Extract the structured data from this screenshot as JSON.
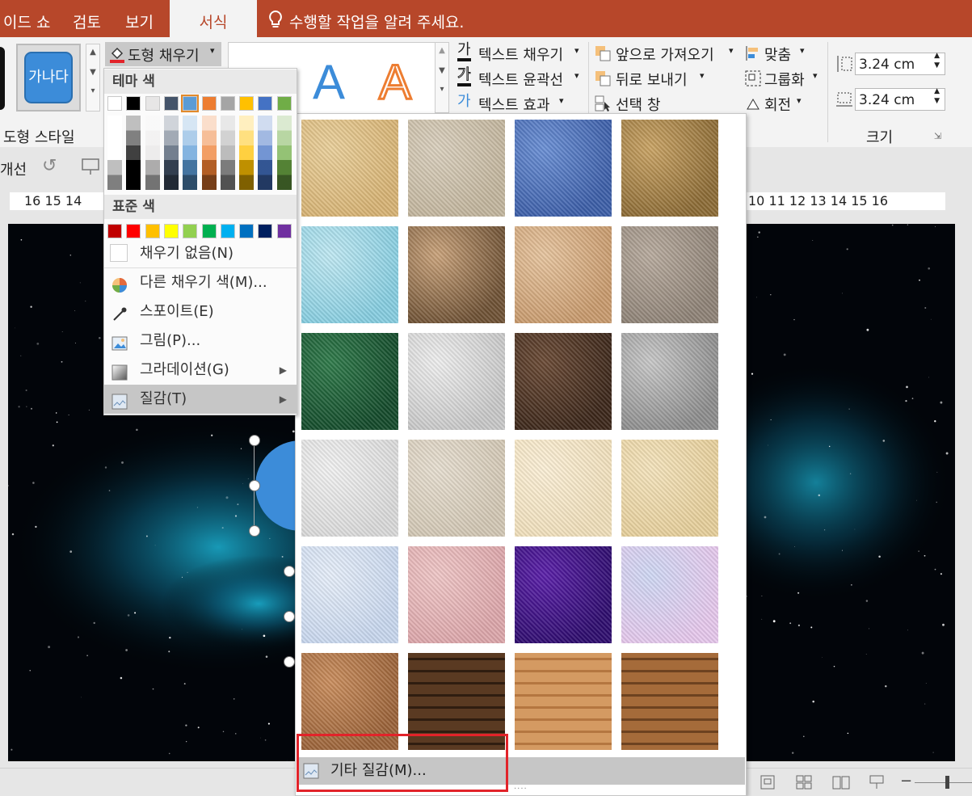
{
  "tabs": [
    {
      "label": "이드 쇼",
      "active": false
    },
    {
      "label": "검토",
      "active": false
    },
    {
      "label": "보기",
      "active": false
    },
    {
      "label": "서식",
      "active": true
    }
  ],
  "tell_me": "수행할 작업을 알려 주세요.",
  "ribbon": {
    "shape_sample": "가나다",
    "shape_fill_label": "도형 채우기",
    "shape_styles_group": "도형 스타일",
    "text_fill": "텍스트 채우기",
    "text_outline": "텍스트 윤곽선",
    "text_effects": "텍스트 효과",
    "text_icon_glyph": "가",
    "wordart_glyph": "A",
    "bring_forward": "앞으로 가져오기",
    "send_backward": "뒤로 보내기",
    "selection_pane": "선택 창",
    "align": "맞춤",
    "group": "그룹화",
    "rotate": "회전",
    "height_value": "3.24 cm",
    "width_value": "3.24 cm",
    "size_group": "크기"
  },
  "qrow": {
    "label": "개선"
  },
  "ruler": {
    "left": "16 15 14",
    "right": "10 11 12 13 14 15 16"
  },
  "menu": {
    "theme_colors_title": "테마 색",
    "theme_colors": [
      "#ffffff",
      "#000000",
      "#e7e6e6",
      "#44546a",
      "#5b9bd5",
      "#ed7d31",
      "#a5a5a5",
      "#ffc000",
      "#4472c4",
      "#70ad47"
    ],
    "standard_colors_title": "표준 색",
    "standard_colors": [
      "#c00000",
      "#ff0000",
      "#ffc000",
      "#ffff00",
      "#92d050",
      "#00b050",
      "#00b0f0",
      "#0070c0",
      "#002060",
      "#7030a0"
    ],
    "no_fill": "채우기 없음(N)",
    "more_colors": "다른 채우기 색(M)...",
    "eyedropper": "스포이트(E)",
    "picture": "그림(P)...",
    "gradient": "그라데이션(G)",
    "texture": "질감(T)"
  },
  "textures": [
    "papyrus",
    "canvas",
    "denim",
    "woven-mat",
    "water-droplets",
    "paper-bag",
    "fish-fossil",
    "sand",
    "green-marble",
    "white-marble",
    "brown-marble",
    "granite",
    "newsprint",
    "recycled-paper",
    "parchment",
    "stationery",
    "blue-tissue-paper",
    "pink-tissue-paper",
    "purple-mesh",
    "bouquet",
    "cork",
    "walnut",
    "oak",
    "medium-wood"
  ],
  "more_textures": "기타 질감(M)...",
  "colors": {
    "accent": "#b7472a",
    "highlight": "#e2232a"
  }
}
